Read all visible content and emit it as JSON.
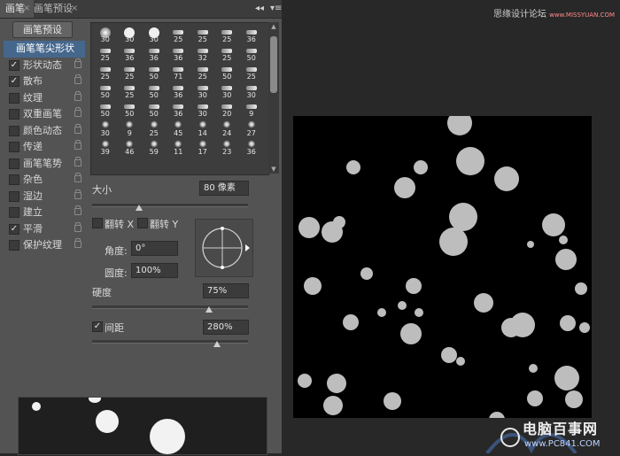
{
  "tabs": [
    {
      "label": "画笔",
      "active": true
    },
    {
      "label": "画笔预设",
      "active": false
    }
  ],
  "panel_controls": {
    "collapse": "◂◂",
    "menu": "▾≡"
  },
  "preset_button_label": "画笔预设",
  "brush_tip_shape_label": "画笔笔尖形状",
  "options": [
    {
      "label": "形状动态",
      "checked": true
    },
    {
      "label": "散布",
      "checked": true
    },
    {
      "label": "纹理",
      "checked": false
    },
    {
      "label": "双重画笔",
      "checked": false
    },
    {
      "label": "颜色动态",
      "checked": false
    },
    {
      "label": "传递",
      "checked": false
    },
    {
      "label": "画笔笔势",
      "checked": false
    },
    {
      "label": "杂色",
      "checked": false
    },
    {
      "label": "湿边",
      "checked": false
    },
    {
      "label": "建立",
      "checked": false
    },
    {
      "label": "平滑",
      "checked": true
    },
    {
      "label": "保护纹理",
      "checked": false
    }
  ],
  "brush_sizes": [
    "30",
    "30",
    "30",
    "25",
    "25",
    "25",
    "36",
    "25",
    "36",
    "36",
    "36",
    "32",
    "25",
    "50",
    "25",
    "25",
    "50",
    "71",
    "25",
    "50",
    "25",
    "50",
    "25",
    "50",
    "36",
    "30",
    "30",
    "30",
    "50",
    "50",
    "50",
    "36",
    "30",
    "20",
    "9",
    "30",
    "9",
    "25",
    "45",
    "14",
    "24",
    "27",
    "39",
    "46",
    "59",
    "11",
    "17",
    "23",
    "36"
  ],
  "size": {
    "label": "大小",
    "value": "80 像素",
    "slider": 0.3
  },
  "flip": {
    "x_label": "翻转 X",
    "y_label": "翻转 Y"
  },
  "angle": {
    "label": "角度:",
    "value": "0°"
  },
  "roundness": {
    "label": "圆度:",
    "value": "100%"
  },
  "hardness": {
    "label": "硬度",
    "value": "75%",
    "slider": 0.75
  },
  "spacing": {
    "label": "间距",
    "value": "280%",
    "checked": true,
    "slider": 0.8
  },
  "watermarks": {
    "top": "思缘设计论坛",
    "top_url": "www.MISSYUAN.COM",
    "bottom_title": "电脑百事网",
    "bottom_url": "www.PC841.COM"
  },
  "colors": {
    "selected": "#45678c",
    "panel": "#535353",
    "dark": "#282828"
  }
}
